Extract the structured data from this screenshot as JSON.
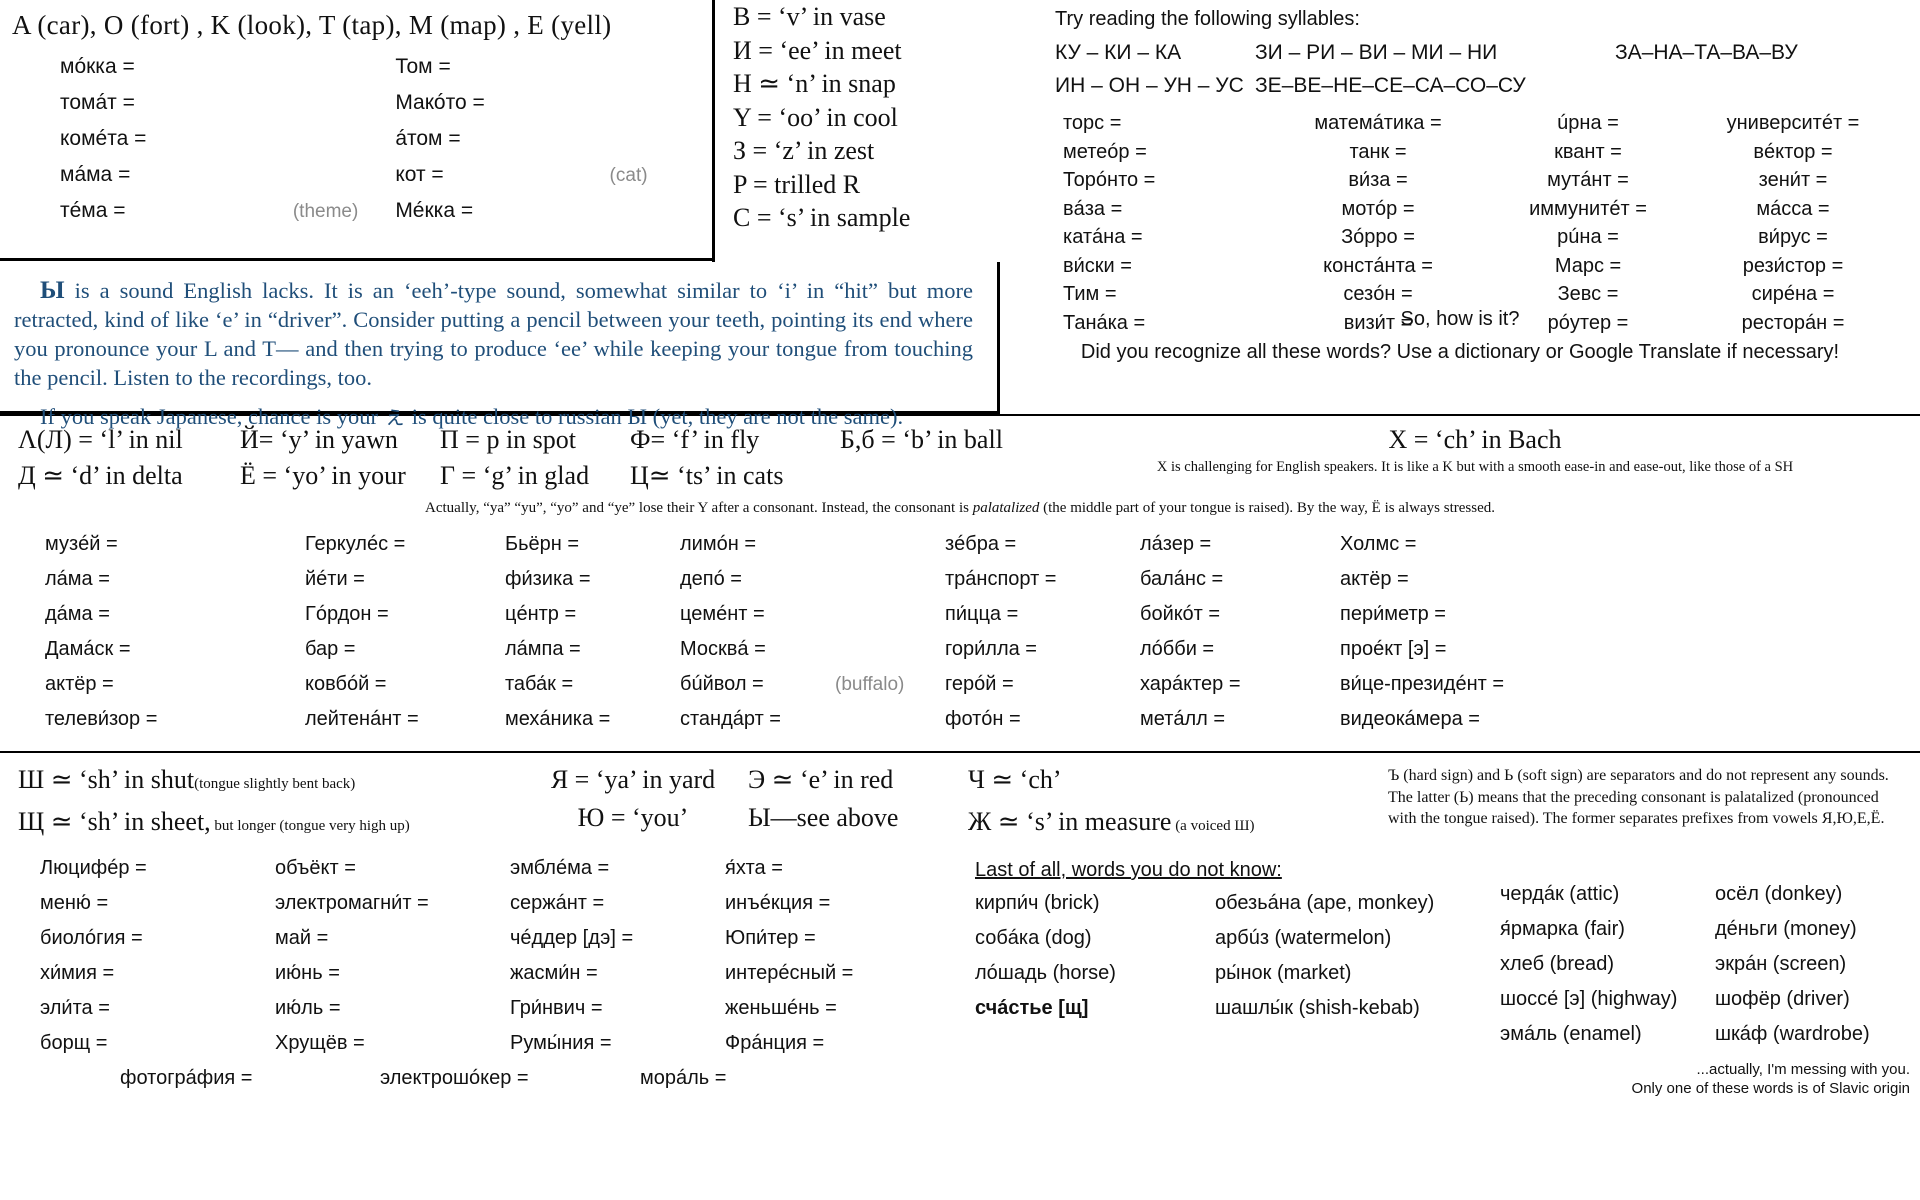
{
  "section1": {
    "vowel_key": "A (car), O  (fort) , K (look), T (tap), M  (map) ,  E (yell)",
    "words_left": [
      {
        "ru": "мóкка =",
        "note": "",
        "ru2": "Том =",
        "note2": ""
      },
      {
        "ru": "томáт =",
        "note": "",
        "ru2": "Макóто =",
        "note2": ""
      },
      {
        "ru": "комéта =",
        "note": "",
        "ru2": "áтом =",
        "note2": ""
      },
      {
        "ru": "мáма =",
        "note": "",
        "ru2": "кот =",
        "note2": "(cat)"
      },
      {
        "ru": "тéма =",
        "note": "(theme)",
        "ru2": "Мéкка =",
        "note2": ""
      }
    ],
    "consonant_key": [
      "B = ‘v’ in vase",
      "И = ‘ee’ in meet",
      "H ≃ ‘n’ in snap",
      "Y = ‘oo’ in cool",
      "З = ‘z’ in zest",
      "P = trilled R",
      "C = ‘s’ in sample"
    ],
    "syllable_intro": "Try reading the following syllables:",
    "syllables": [
      {
        "a": "КУ – КИ – КА",
        "b": "ЗИ – РИ – ВИ – МИ – НИ",
        "c": "ЗА–НА–ТА–ВА–ВУ"
      },
      {
        "a": "ИН – ОН – УН – УС",
        "b": "ЗЕ–ВЕ–НЕ–СЕ–СА–СО–СУ",
        "c": ""
      }
    ],
    "words_right": [
      [
        "торс  =",
        "матемáтика =",
        "úрна =",
        "университéт ="
      ],
      [
        "метеóр =",
        "танк =",
        "квант =",
        "вéктор ="
      ],
      [
        "Торóнто =",
        "ви́за =",
        "мутáнт =",
        "зени́т ="
      ],
      [
        "вáза =",
        "мотóр =",
        "иммунитéт =",
        "мáсса ="
      ],
      [
        "катáна =",
        "Зóрро =",
        "рúна =",
        "ви́рус ="
      ],
      [
        "ви́ски =",
        "констáнта =",
        "Марс =",
        "рези́стор ="
      ],
      [
        "Тим =",
        "сезóн =",
        "Зевс =",
        "сирéна ="
      ],
      [
        "Танáка =",
        "визи́т =",
        "рóутер =",
        "ресторáн ="
      ]
    ]
  },
  "section2": {
    "para1_lead": "Ы",
    "para1": " is a sound English lacks. It is an ‘eeh’-type sound, somewhat similar to ‘i’ in “hit” but more retracted, kind of like ‘e’ in “driver”. Consider putting a pencil between your teeth, pointing its end where you pronounce your L and T— and then trying to produce ‘ee’ while keeping your tongue from touching the pencil. Listen to the recordings, too.",
    "para2": "If you speak Japanese, chance is your ぇ is quite close to russian Ы (yet, they are not the same).",
    "question1": "So, how is it?",
    "question2": "Did you recognize all these words? Use a dictionary or Google Translate if necessary!"
  },
  "section3": {
    "letters": [
      {
        "l1": "Λ(Л) = ‘l’ in nil",
        "l2": "Д ≃ ‘d’ in delta"
      },
      {
        "l1": "Й= ‘y’ in yawn",
        "l2": "Ё = ‘yo’ in your"
      },
      {
        "l1": "П = p in spot",
        "l2": "Г = ‘g’ in glad"
      },
      {
        "l1": "Ф= ‘f’ in fly",
        "l2": "Ц≃ ‘ts’ in cats"
      },
      {
        "l1": "Б,б = ‘b’ in ball",
        "l2": ""
      }
    ],
    "x_letter": "X = ‘ch’ in Bach",
    "x_note": "X is challenging for English speakers. It is like a K but with a smooth ease-in and ease-out, like those of a SH",
    "palatal_note_a": "Actually,  “ya” “yu”, “yo” and “ye” lose their Y after a consonant. Instead, the consonant is ",
    "palatal_note_em": "palatalized",
    "palatal_note_b": " (the middle part of your tongue is raised). By the way, Ё is always stressed.",
    "words": [
      [
        "музéй =",
        "Геркулéс =",
        "Бьёрн =",
        "лимóн =",
        "",
        "зéбра =",
        "лáзер =",
        "Холмс ="
      ],
      [
        "лáма =",
        "йéти =",
        "фи́зика =",
        "депó =",
        "",
        "трáнспорт =",
        "балáнс =",
        "актёр ="
      ],
      [
        "дáма =",
        "Гóрдон =",
        "цéнтр =",
        "цемéнт =",
        "",
        "пи́цца =",
        "бойкóт =",
        "пери́метр ="
      ],
      [
        "Дамáск =",
        "бар =",
        "лáмпа =",
        "Москвá =",
        "",
        "гори́лла =",
        "лóбби =",
        "проéкт [э] ="
      ],
      [
        "актёр =",
        "ковбóй =",
        "таба́к =",
        "бúйвол =",
        "(buffalo)",
        "герóй =",
        "харáктер =",
        "ви́це-президéнт ="
      ],
      [
        "телеви́зор =",
        "лейтенáнт =",
        "мехáника =",
        "стандáрт =",
        "",
        "фотóн =",
        "метáлл =",
        "видеокáмера ="
      ]
    ]
  },
  "section4": {
    "letters_col1": [
      {
        "main": "Ш ≃ ‘sh’ in shut",
        "sub": "(tongue slightly bent back)"
      },
      {
        "main": "Щ ≃ ‘sh’ in sheet,",
        "sub": " but longer  (tongue very high up)"
      }
    ],
    "letters_col2": [
      {
        "main": "Я = ‘ya’ in yard",
        "sub": ""
      },
      {
        "main": "Ю = ‘you’",
        "sub": ""
      }
    ],
    "letters_col3": [
      {
        "main": "Э ≃ ‘e’ in red",
        "sub": ""
      },
      {
        "main": "Ы—see above",
        "sub": ""
      }
    ],
    "letters_col4": [
      {
        "main": "Ч  ≃ ‘ch’",
        "sub": ""
      },
      {
        "main": "Ж ≃ ‘s’ in measure",
        "sub": " (a voiced Ш)"
      }
    ],
    "signs_note": "Ъ (hard sign) and Ь (soft sign) are separators and do not represent any sounds. The latter (Ь) means that the preceding consonant is palatalized (pronounced with the tongue raised). The former separates prefixes from vowels Я,Ю,Е,Ё.",
    "words": [
      [
        "Люцифéр =",
        "объёкт =",
        "эмблéма =",
        "я́хта ="
      ],
      [
        "меню́ =",
        "электромагни́т =",
        "сержáнт =",
        "инъéкция ="
      ],
      [
        "биолóгия =",
        "май =",
        "чéддер [дэ] =",
        "Юпи́тер ="
      ],
      [
        "хи́мия =",
        "ию́нь =",
        "жасми́н =",
        "интерéсный ="
      ],
      [
        "эли́та =",
        "ию́ль =",
        "Гри́нвич =",
        "женьшéнь ="
      ],
      [
        "борщ =",
        "Хрущёв =",
        "Румы́ния =",
        "Фрáнция ="
      ]
    ],
    "bottom_words": [
      "фотогрáфия =",
      "электрошóкер =",
      "морáль ="
    ],
    "unknown_title": "Last of all, words you do not know:",
    "unknown_words": [
      [
        "кирпи́ч (brick)",
        "обезьáна (ape, monkey)",
        "чердáк (attic)",
        "осёл (donkey)"
      ],
      [
        "собáка (dog)",
        "арбúз (watermelon)",
        "я́рмарка (fair)",
        "дéньги (money)"
      ],
      [
        "лóшадь (horse)",
        "ры́нок (market)",
        "хлеб (bread)",
        "экрáн (screen)"
      ],
      [
        "шашлы́к (shish-kebab)",
        "",
        "шоссе́ [э] (highway)",
        "шофёр (driver)"
      ],
      [
        "счáстье [щ]",
        "",
        "эмáль (enamel)",
        "шкáф (wardrobe)"
      ]
    ],
    "footnote1": "...actually, I'm messing with you.",
    "footnote2": "Only one of these words is of Slavic origin"
  },
  "colors": {
    "blue_text": "#1f4e79",
    "gray_gloss": "#8a8a8a",
    "rule": "#000000"
  }
}
